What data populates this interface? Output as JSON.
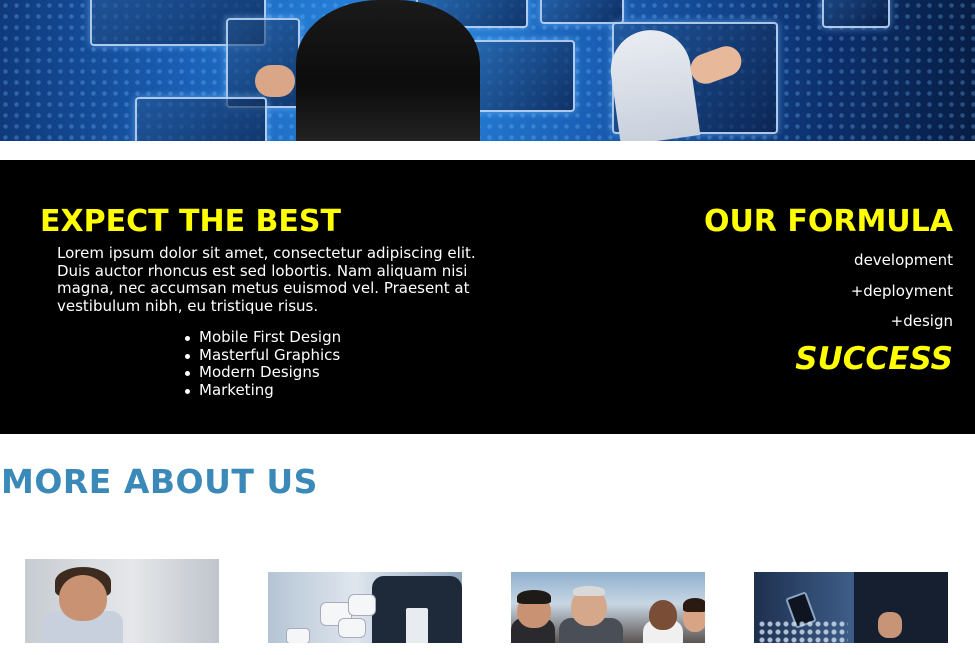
{
  "hero": {
    "alt": "Business person interacting with holographic touchscreen panels over a world map"
  },
  "expect": {
    "heading": "EXPECT THE BEST",
    "paragraph": "Lorem ipsum dolor sit amet, consectetur adipiscing elit. Duis auctor rhoncus est sed lobortis. Nam aliquam nisi magna, nec accumsan metus euismod vel. Praesent at vestibulum nibh, eu tristique risus.",
    "features": [
      "Mobile First Design",
      "Masterful Graphics",
      "Modern Designs",
      "Marketing"
    ]
  },
  "formula": {
    "heading": "OUR FORMULA",
    "lines": [
      "development",
      "+deployment",
      "+design"
    ],
    "result": "SUCCESS"
  },
  "more": {
    "heading": "MORE ABOUT US"
  },
  "colors": {
    "accent_yellow": "#ffff00",
    "band_background": "#000000",
    "heading_blue": "#3a89b8"
  },
  "icons": {
    "bullet": "bullet-dot-icon"
  }
}
